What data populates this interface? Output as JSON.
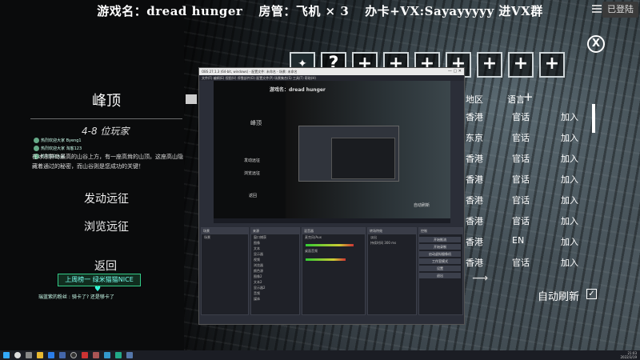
{
  "banner": {
    "game": "游戏名：dread hunger",
    "room": "房管：飞机 × 3",
    "card": "办卡+VX:Sayayyyyy 进VX群"
  },
  "logged_in": "已登陆",
  "close_label": "X",
  "map": {
    "title": "峰顶",
    "players": "4-8 位玩家",
    "description": "在冰冻群岛最高的山谷上方，有一座高耸的山顶。这座高山隐藏着通过的秘密，而山谷则是您成功的关键！"
  },
  "chat": [
    {
      "user": "热烈欢迎大家",
      "text": "Byeng1"
    },
    {
      "user": "热烈欢迎大家",
      "text": "淘客123"
    },
    {
      "user": "热烈欢迎大家",
      "text": ""
    }
  ],
  "menu": {
    "start": "发动远征",
    "browse": "浏览远征",
    "back": "返回"
  },
  "gift": {
    "label": "上周榜一 绿米猫猫NICE",
    "heart": "♥",
    "bottom_chat": "瑞蓝紫的粉丝 : 骑卡了? 还是够卡了"
  },
  "slots": [
    "",
    "?",
    "+",
    "+",
    "+",
    "+",
    "+",
    "+",
    "+"
  ],
  "list": {
    "header_region": "地区",
    "header_lang": "语言",
    "header_add": "+",
    "rows": [
      {
        "region": "香港",
        "lang": "官话",
        "action": "加入"
      },
      {
        "region": "东京",
        "lang": "官话",
        "action": "加入"
      },
      {
        "region": "香港",
        "lang": "官话",
        "action": "加入"
      },
      {
        "region": "香港",
        "lang": "官话",
        "action": "加入"
      },
      {
        "region": "香港",
        "lang": "官话",
        "action": "加入"
      },
      {
        "region": "香港",
        "lang": "官话",
        "action": "加入"
      },
      {
        "region": "香港",
        "lang": "EN",
        "action": "加入"
      },
      {
        "region": "香港",
        "lang": "官话",
        "action": "加入"
      }
    ],
    "auto_refresh": "自动刷新",
    "auto_refresh_check": "✓"
  },
  "obs": {
    "title": "OBS 27.1.3 (64-bit, windows) - 配置文件: 未命名 - 场景: 未命名",
    "menu": "文件(F)  编辑(E)  视图(V)  停靠部件(D)  配置文件(P)  场景集合(S)  工具(T)  帮助(H)",
    "preview_title": "游戏名：dread hunger",
    "preview_peak": "峰顶",
    "preview_start": "发动远征",
    "preview_browse": "浏览远征",
    "preview_back": "返回",
    "preview_auto": "自动刷新",
    "docks": {
      "scenes": "场景",
      "sources": "来源",
      "mixer": "混音器",
      "transitions": "转场特效",
      "controls": "控制"
    },
    "scene_item": "场景",
    "source_items": [
      "窗口捕获",
      "图像",
      "文本",
      "显示器",
      "视频",
      "浏览器",
      "颜色源",
      "图像2",
      "文本2",
      "显示器2",
      "音频",
      "媒体"
    ],
    "mixer_items": [
      "麦克风/Aux",
      "桌面音频"
    ],
    "transition_items": [
      "淡出",
      "持续时间 300 ms"
    ],
    "control_buttons": [
      "开始推流",
      "开始录制",
      "启动虚拟摄像机",
      "工作室模式",
      "设置",
      "退出"
    ]
  },
  "taskbar": {
    "time": "21:03",
    "date": "2022/3/19"
  }
}
